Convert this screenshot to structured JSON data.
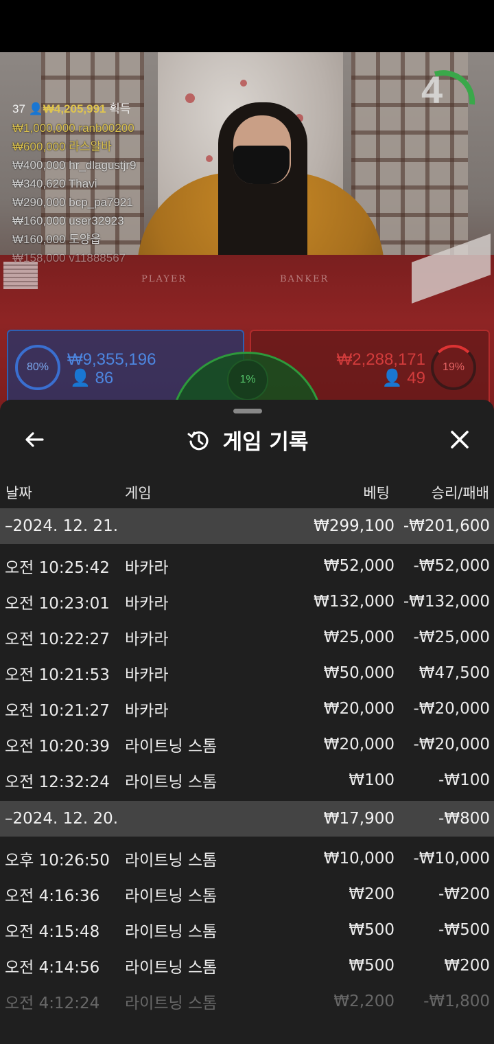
{
  "game": {
    "countdown": "4",
    "winners_header": {
      "count": "37",
      "amount": "₩4,205,991",
      "suffix": "획득"
    },
    "winners": [
      {
        "amount": "₩1,000,000",
        "name": "ranb00200"
      },
      {
        "amount": "₩600,000",
        "name": "라스알바"
      },
      {
        "amount": "₩400,000",
        "name": "hr_dlagustjr9"
      },
      {
        "amount": "₩340,620",
        "name": "Thavi"
      },
      {
        "amount": "₩290,000",
        "name": "bcp_pa7921"
      },
      {
        "amount": "₩160,000",
        "name": "user32923"
      },
      {
        "amount": "₩160,000",
        "name": "도양읍"
      },
      {
        "amount": "₩158,000",
        "name": "v11888567"
      }
    ],
    "table_labels": {
      "player": "PLAYER",
      "banker": "BANKER"
    },
    "player": {
      "percent": "80%",
      "amount": "₩9,355,196",
      "count": "86"
    },
    "banker": {
      "percent": "19%",
      "amount": "₩2,288,171",
      "count": "49"
    },
    "tie": {
      "percent": "1%"
    }
  },
  "history": {
    "title": "게임 기록",
    "columns": {
      "date": "날짜",
      "game": "게임",
      "bet": "베팅",
      "win_loss": "승리/패배"
    },
    "days": [
      {
        "date": "–2024. 12. 21.",
        "bet": "₩299,100",
        "win_loss": "-₩201,600",
        "rows": [
          {
            "time": "오전 10:25:42",
            "game": "바카라",
            "bet": "₩52,000",
            "win_loss": "-₩52,000"
          },
          {
            "time": "오전 10:23:01",
            "game": "바카라",
            "bet": "₩132,000",
            "win_loss": "-₩132,000"
          },
          {
            "time": "오전 10:22:27",
            "game": "바카라",
            "bet": "₩25,000",
            "win_loss": "-₩25,000"
          },
          {
            "time": "오전 10:21:53",
            "game": "바카라",
            "bet": "₩50,000",
            "win_loss": "₩47,500"
          },
          {
            "time": "오전 10:21:27",
            "game": "바카라",
            "bet": "₩20,000",
            "win_loss": "-₩20,000"
          },
          {
            "time": "오전 10:20:39",
            "game": "라이트닝 스톰",
            "bet": "₩20,000",
            "win_loss": "-₩20,000"
          },
          {
            "time": "오전 12:32:24",
            "game": "라이트닝 스톰",
            "bet": "₩100",
            "win_loss": "-₩100"
          }
        ]
      },
      {
        "date": "–2024. 12. 20.",
        "bet": "₩17,900",
        "win_loss": "-₩800",
        "rows": [
          {
            "time": "오후 10:26:50",
            "game": "라이트닝 스톰",
            "bet": "₩10,000",
            "win_loss": "-₩10,000"
          },
          {
            "time": "오전 4:16:36",
            "game": "라이트닝 스톰",
            "bet": "₩200",
            "win_loss": "-₩200"
          },
          {
            "time": "오전 4:15:48",
            "game": "라이트닝 스톰",
            "bet": "₩500",
            "win_loss": "-₩500"
          },
          {
            "time": "오전 4:14:56",
            "game": "라이트닝 스톰",
            "bet": "₩500",
            "win_loss": "₩200"
          },
          {
            "time": "오전 4:12:24",
            "game": "라이트닝 스톰",
            "bet": "₩2,200",
            "win_loss": "-₩1,800"
          }
        ]
      }
    ]
  },
  "colors": {
    "player_blue": "#4d86e0",
    "banker_red": "#d33c3c",
    "tie_green": "#2e9a3c",
    "gold": "#e0c54e"
  }
}
